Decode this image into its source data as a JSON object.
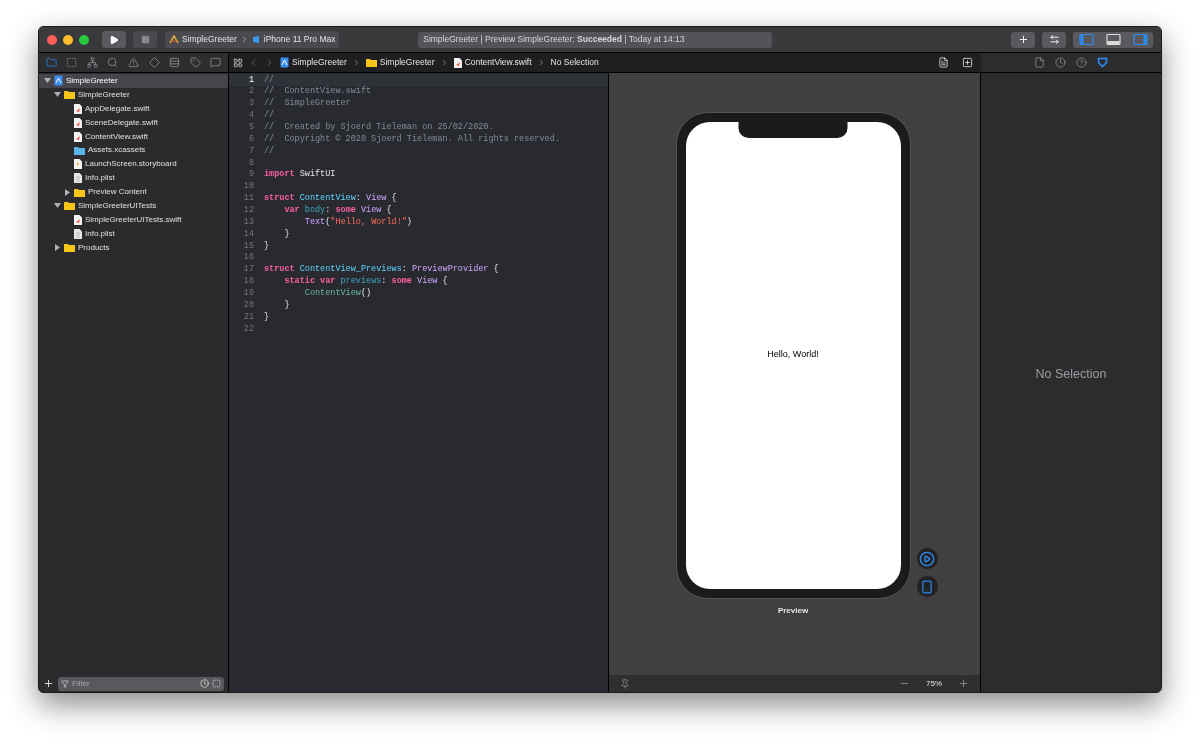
{
  "toolbar": {
    "scheme": "SimpleGreeter",
    "destination": "iPhone 11 Pro Max",
    "status": "SimpleGreeter | Preview SimpleGreeter: **Succeeded** | Today at 14:13",
    "panel_toggles": [
      {
        "kind": "left",
        "on": true
      },
      {
        "kind": "bottom",
        "on": false
      },
      {
        "kind": "right",
        "on": true
      }
    ]
  },
  "navigator": {
    "tabs": [
      {
        "kind": "folder",
        "selected": true
      },
      {
        "kind": "source",
        "selected": false
      },
      {
        "kind": "symbols",
        "selected": false
      },
      {
        "kind": "search",
        "selected": false
      },
      {
        "kind": "issues",
        "selected": false
      },
      {
        "kind": "tests",
        "selected": false
      },
      {
        "kind": "debug",
        "selected": false
      },
      {
        "kind": "breakpoints",
        "selected": false
      },
      {
        "kind": "reports",
        "selected": false
      }
    ],
    "tree": [
      {
        "label": "SimpleGreeter",
        "kind": "project",
        "selected": true,
        "expanded": true,
        "children": [
          {
            "label": "SimpleGreeter",
            "kind": "folder",
            "selected": false,
            "expanded": true,
            "children": [
              {
                "label": "AppDelegate.swift",
                "kind": "swift",
                "selected": false
              },
              {
                "label": "SceneDelegate.swift",
                "kind": "swift",
                "selected": false
              },
              {
                "label": "ContentView.swift",
                "kind": "swift",
                "selected": false
              },
              {
                "label": "Assets.xcassets",
                "kind": "assets",
                "selected": false
              },
              {
                "label": "LaunchScreen.storyboard",
                "kind": "storyboard",
                "selected": false
              },
              {
                "label": "Info.plist",
                "kind": "plist",
                "selected": false
              },
              {
                "label": "Preview Content",
                "kind": "folder",
                "selected": false,
                "expanded": false
              }
            ]
          },
          {
            "label": "SimpleGreeterUITests",
            "kind": "folder",
            "selected": false,
            "expanded": true,
            "children": [
              {
                "label": "SimpleGreeterUITests.swift",
                "kind": "swift",
                "selected": false
              },
              {
                "label": "Info.plist",
                "kind": "plist",
                "selected": false
              }
            ]
          },
          {
            "label": "Products",
            "kind": "folder",
            "selected": false,
            "expanded": false
          }
        ]
      }
    ],
    "filter": {
      "placeholder": "Filter"
    }
  },
  "jump_bar": {
    "crumbs": [
      {
        "label": "SimpleGreeter",
        "kind": "project"
      },
      {
        "label": "SimpleGreeter",
        "kind": "folder"
      },
      {
        "label": "ContentView.swift",
        "kind": "swift"
      }
    ],
    "tail": "No Selection"
  },
  "editor": {
    "lines": [
      {
        "number": "1",
        "current": true,
        "tokens": [
          {
            "text": "//",
            "kind": "comment"
          }
        ]
      },
      {
        "number": "2",
        "current": false,
        "tokens": [
          {
            "text": "//  ContentView.swift",
            "kind": "comment"
          }
        ]
      },
      {
        "number": "3",
        "current": false,
        "tokens": [
          {
            "text": "//  SimpleGreeter",
            "kind": "comment"
          }
        ]
      },
      {
        "number": "4",
        "current": false,
        "tokens": [
          {
            "text": "//",
            "kind": "comment"
          }
        ]
      },
      {
        "number": "5",
        "current": false,
        "tokens": [
          {
            "text": "//  Created by Sjoerd Tieleman on 25/02/2020.",
            "kind": "comment"
          }
        ]
      },
      {
        "number": "6",
        "current": false,
        "tokens": [
          {
            "text": "//  Copyright © 2020 Sjoerd Tieleman. All rights reserved.",
            "kind": "comment"
          }
        ]
      },
      {
        "number": "7",
        "current": false,
        "tokens": [
          {
            "text": "//",
            "kind": "comment"
          }
        ]
      },
      {
        "number": "8",
        "current": false
      },
      {
        "number": "9",
        "current": false,
        "tokens": [
          {
            "text": "import",
            "kind": "keyword"
          },
          {
            "text": " SwiftUI",
            "kind": "plain"
          }
        ]
      },
      {
        "number": "10",
        "current": false
      },
      {
        "number": "11",
        "current": false,
        "tokens": [
          {
            "text": "struct",
            "kind": "keyword"
          },
          {
            "text": " ContentView",
            "kind": "decl"
          },
          {
            "text": ":",
            "kind": "plain"
          },
          {
            "text": " View",
            "kind": "type"
          },
          {
            "text": " {",
            "kind": "plain"
          }
        ]
      },
      {
        "number": "12",
        "current": false,
        "tokens": [
          {
            "text": "    var",
            "kind": "keyword"
          },
          {
            "text": " body",
            "kind": "property"
          },
          {
            "text": ":",
            "kind": "plain"
          },
          {
            "text": " some",
            "kind": "keyword"
          },
          {
            "text": " View",
            "kind": "type"
          },
          {
            "text": " {",
            "kind": "plain"
          }
        ]
      },
      {
        "number": "13",
        "current": false,
        "tokens": [
          {
            "text": "        Text",
            "kind": "type"
          },
          {
            "text": "(",
            "kind": "plain"
          },
          {
            "text": "\"Hello, World!\"",
            "kind": "string"
          },
          {
            "text": ")",
            "kind": "plain"
          }
        ]
      },
      {
        "number": "14",
        "current": false,
        "tokens": [
          {
            "text": "    }",
            "kind": "plain"
          }
        ]
      },
      {
        "number": "15",
        "current": false,
        "tokens": [
          {
            "text": "}",
            "kind": "plain"
          }
        ]
      },
      {
        "number": "16",
        "current": false
      },
      {
        "number": "17",
        "current": false,
        "tokens": [
          {
            "text": "struct",
            "kind": "keyword"
          },
          {
            "text": " ContentView_Previews",
            "kind": "decl"
          },
          {
            "text": ":",
            "kind": "plain"
          },
          {
            "text": " PreviewProvider",
            "kind": "type"
          },
          {
            "text": " {",
            "kind": "plain"
          }
        ]
      },
      {
        "number": "18",
        "current": false,
        "tokens": [
          {
            "text": "    static",
            "kind": "keyword"
          },
          {
            "text": " var",
            "kind": "keyword"
          },
          {
            "text": " previews",
            "kind": "property"
          },
          {
            "text": ":",
            "kind": "plain"
          },
          {
            "text": " some",
            "kind": "keyword"
          },
          {
            "text": " View",
            "kind": "type"
          },
          {
            "text": " {",
            "kind": "plain"
          }
        ]
      },
      {
        "number": "19",
        "current": false,
        "tokens": [
          {
            "text": "        ContentView",
            "kind": "call"
          },
          {
            "text": "()",
            "kind": "plain"
          }
        ]
      },
      {
        "number": "20",
        "current": false,
        "tokens": [
          {
            "text": "    }",
            "kind": "plain"
          }
        ]
      },
      {
        "number": "21",
        "current": false,
        "tokens": [
          {
            "text": "}",
            "kind": "plain"
          }
        ]
      },
      {
        "number": "22",
        "current": false
      }
    ]
  },
  "canvas": {
    "greeting": "Hello, World!",
    "caption": "Preview",
    "zoom": "75%"
  },
  "inspector": {
    "tabs": [
      {
        "kind": "file",
        "selected": false
      },
      {
        "kind": "history",
        "selected": false
      },
      {
        "kind": "help",
        "selected": false
      },
      {
        "kind": "attributes",
        "selected": true
      }
    ],
    "empty_message": "No Selection"
  }
}
